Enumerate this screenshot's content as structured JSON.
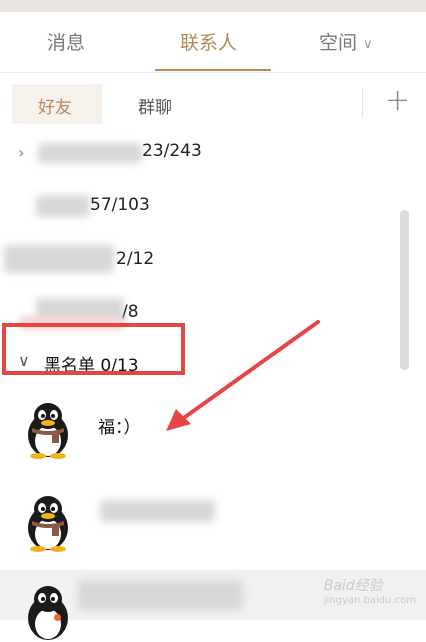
{
  "tabs": {
    "messages": "消息",
    "contacts": "联系人",
    "space": "空间",
    "space_chevron": "∨"
  },
  "subtabs": {
    "friends": "好友",
    "groups": "群聊",
    "add": "+"
  },
  "groups": [
    {
      "count": "23/243",
      "expanded": false
    },
    {
      "count": "57/103"
    },
    {
      "count": "2/12"
    },
    {
      "count": "/8"
    }
  ],
  "blacklist": {
    "label": "黑名单 0/13",
    "expanded": true
  },
  "contacts": [
    {
      "name": "福：）",
      "icon": "penguin-avatar"
    },
    {
      "name": "",
      "icon": "penguin-avatar"
    },
    {
      "name": "",
      "icon": "penguin-avatar"
    }
  ],
  "annotation": {
    "box_color": "#e64545",
    "arrow_color": "#e64545"
  },
  "watermark": {
    "text": "Baid经验",
    "url": "jingyan.baidu.com"
  },
  "colors": {
    "accent": "#b48a5e",
    "highlight_row": "#f1f1f1"
  }
}
